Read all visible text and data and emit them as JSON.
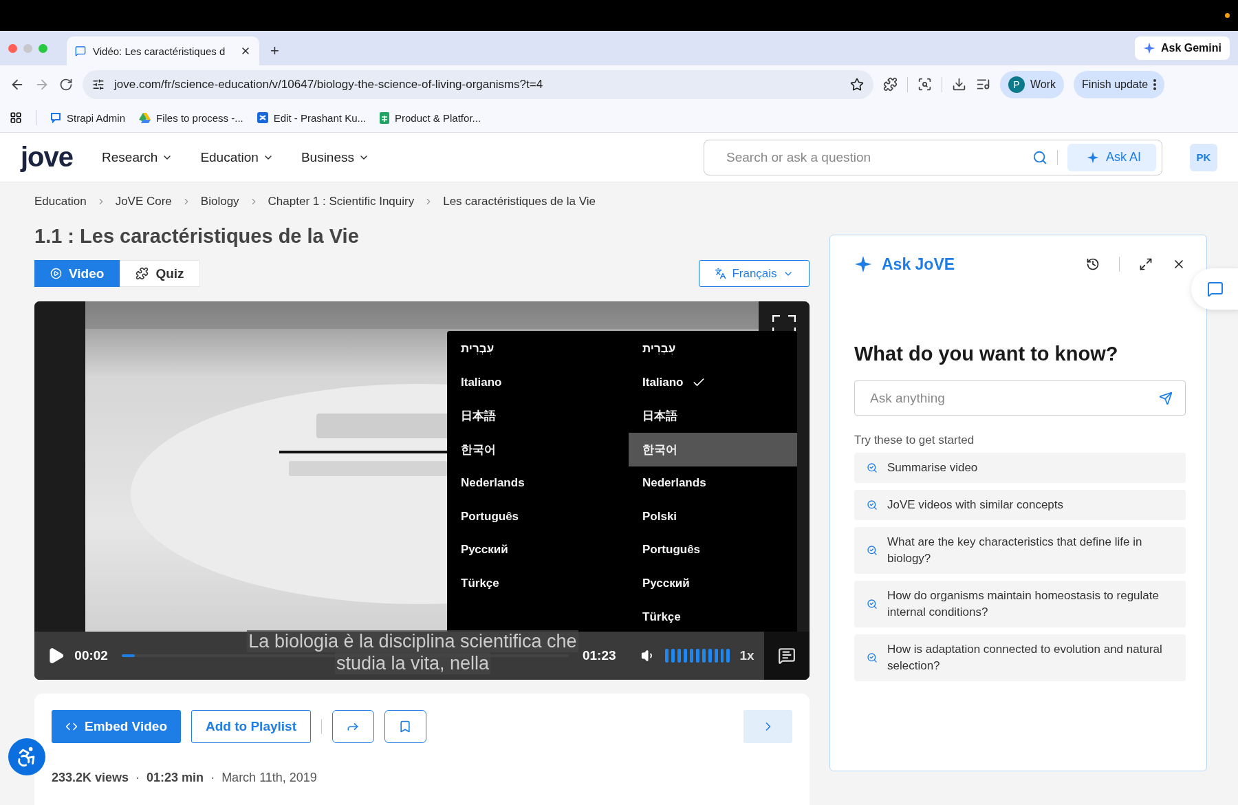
{
  "browser": {
    "tabs": [
      {
        "title": "Vidéo: Les caractéristiques d",
        "selected": true
      }
    ],
    "new_tab": "+",
    "ask_gemini": "Ask Gemini",
    "url": "jove.com/fr/science-education/v/10647/biology-the-science-of-living-organisms?t=4",
    "profile": {
      "initial": "P",
      "label": "Work"
    },
    "finish_update": "Finish update",
    "bookmarks": [
      {
        "label": "Strapi Admin",
        "kind": "chat"
      },
      {
        "label": "Files to process -...",
        "kind": "drive"
      },
      {
        "label": "Edit - Prashant Ku...",
        "kind": "confluence"
      },
      {
        "label": "Product & Platfor...",
        "kind": "sheet"
      }
    ]
  },
  "header": {
    "logo": "jove",
    "nav": [
      "Research",
      "Education",
      "Business"
    ],
    "search": {
      "placeholder": "Search or ask a question"
    },
    "ask_ai": "Ask AI",
    "avatar": "PK"
  },
  "breadcrumb": [
    "Education",
    "JoVE Core",
    "Biology",
    "Chapter 1 : Scientific Inquiry",
    "Les caractéristiques de la Vie"
  ],
  "title": "1.1 : Les caractéristiques de la Vie",
  "view_tabs": [
    {
      "label": "Video",
      "kind": "video",
      "selected": true
    },
    {
      "label": "Quiz",
      "kind": "quiz",
      "selected": false
    }
  ],
  "language_button": "Français",
  "player": {
    "current": "00:02",
    "duration": "01:23",
    "progress": {
      "level": 0.03
    },
    "volume": {
      "level": 1
    },
    "speed": "1x",
    "subtitle": [
      "La biologia è la disciplina scientifica che",
      "studia la vita, nella"
    ],
    "menu": {
      "columns": [
        [
          {
            "label": "עִבְרִית",
            "selected": false,
            "hovered": false
          },
          {
            "label": "Italiano",
            "selected": false,
            "hovered": false
          },
          {
            "label": "日本語",
            "selected": false,
            "hovered": false
          },
          {
            "label": "한국어",
            "selected": false,
            "hovered": false
          },
          {
            "label": "Nederlands",
            "selected": false,
            "hovered": false
          },
          {
            "label": "Português",
            "selected": false,
            "hovered": false
          },
          {
            "label": "Русский",
            "selected": false,
            "hovered": false
          },
          {
            "label": "Türkçe",
            "selected": false,
            "hovered": false
          }
        ],
        [
          {
            "label": "עִבְרִית",
            "selected": false,
            "hovered": false
          },
          {
            "label": "Italiano",
            "selected": true,
            "hovered": false
          },
          {
            "label": "日本語",
            "selected": false,
            "hovered": false
          },
          {
            "label": "한국어",
            "selected": false,
            "hovered": true
          },
          {
            "label": "Nederlands",
            "selected": false,
            "hovered": false
          },
          {
            "label": "Polski",
            "selected": false,
            "hovered": false
          },
          {
            "label": "Português",
            "selected": false,
            "hovered": false
          },
          {
            "label": "Русский",
            "selected": false,
            "hovered": false
          },
          {
            "label": "Türkçe",
            "selected": false,
            "hovered": false
          }
        ]
      ]
    }
  },
  "actions": {
    "embed": "Embed Video",
    "playlist": "Add to Playlist"
  },
  "meta": [
    {
      "text": "233.2K views",
      "kind": "stat"
    },
    {
      "text": "·",
      "kind": "separator"
    },
    {
      "text": "01:23 min",
      "kind": "stat"
    },
    {
      "text": "·",
      "kind": "separator"
    },
    {
      "text": "March 11th, 2019",
      "kind": "date"
    }
  ],
  "ask_panel": {
    "title": "Ask JoVE",
    "heading": "What do you want to know?",
    "input": {
      "placeholder": "Ask anything"
    },
    "hint": "Try these to get started",
    "suggestions": [
      "Summarise video",
      "JoVE videos with similar concepts",
      "What are the key characteristics that define life in biology?",
      "How do organisms maintain homeostasis to regulate internal conditions?",
      "How is adaptation connected to evolution and natural selection?"
    ]
  }
}
